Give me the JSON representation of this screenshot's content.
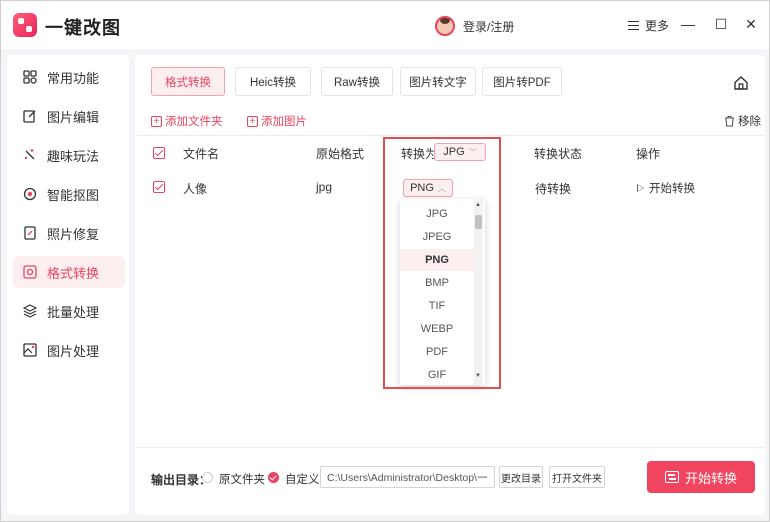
{
  "app": {
    "title": "一键改图"
  },
  "header": {
    "login_label": "登录/注册",
    "more_label": "更多",
    "minimize_glyph": "—",
    "maximize_glyph": "☐",
    "close_glyph": "✕"
  },
  "sidebar": {
    "items": [
      {
        "label": "常用功能",
        "icon": "grid-icon"
      },
      {
        "label": "图片编辑",
        "icon": "edit-icon"
      },
      {
        "label": "趣味玩法",
        "icon": "sparkle-icon"
      },
      {
        "label": "智能抠图",
        "icon": "target-icon"
      },
      {
        "label": "照片修复",
        "icon": "repair-icon"
      },
      {
        "label": "格式转换",
        "icon": "convert-icon",
        "active": true
      },
      {
        "label": "批量处理",
        "icon": "layers-icon"
      },
      {
        "label": "图片处理",
        "icon": "image-icon"
      }
    ]
  },
  "tabs": [
    {
      "label": "格式转换",
      "active": true
    },
    {
      "label": "Heic转换"
    },
    {
      "label": "Raw转换"
    },
    {
      "label": "图片转文字"
    },
    {
      "label": "图片转PDF"
    }
  ],
  "toolbar": {
    "add_folder": "添加文件夹",
    "add_image": "添加图片",
    "remove": "移除"
  },
  "table": {
    "headers": {
      "filename": "文件名",
      "original_format": "原始格式",
      "convert_to": "转换为",
      "convert_to_value": "JPG",
      "status": "转换状态",
      "action": "操作"
    },
    "rows": [
      {
        "filename": "人像",
        "original_format": "jpg",
        "convert_to": "PNG",
        "status": "待转换",
        "action": "开始转换"
      }
    ]
  },
  "dropdown": {
    "options": [
      "JPG",
      "JPEG",
      "PNG",
      "BMP",
      "TIF",
      "WEBP",
      "PDF",
      "GIF"
    ],
    "selected": "PNG"
  },
  "footer": {
    "output_label": "输出目录：",
    "option_original": "原文件夹",
    "option_custom": "自定义",
    "path_value": "C:\\Users\\Administrator\\Desktop\\一...",
    "change_dir": "更改目录",
    "open_folder": "打开文件夹",
    "start_button": "开始转换"
  },
  "colors": {
    "accent": "#e8445f",
    "highlight_border": "#e05050"
  }
}
